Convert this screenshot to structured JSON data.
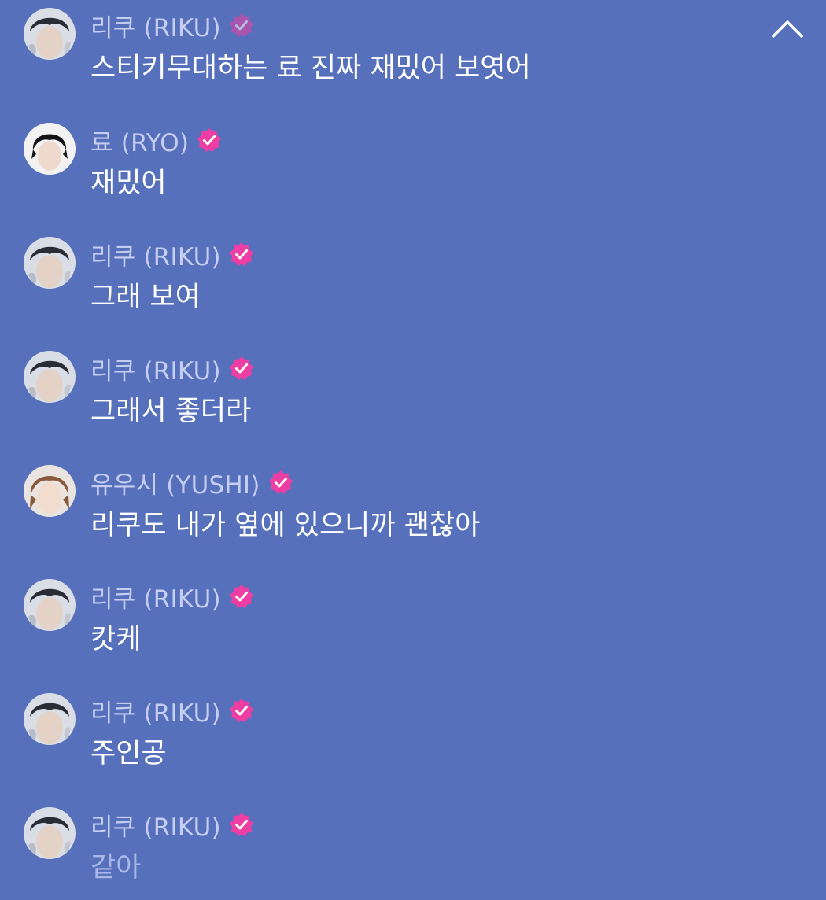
{
  "chat": {
    "collapse_icon": "chevron-up-icon",
    "verified_icon": "verified-badge-icon",
    "colors": {
      "background": "#5670bb",
      "name": "#c5cdf0",
      "message": "#ffffff",
      "badge": "#ee3ea3"
    },
    "messages": [
      {
        "author": "리쿠 (RIKU)",
        "avatar": "riku-avatar",
        "text": "스티키무대하는 료 진짜 재밌어 보엿어"
      },
      {
        "author": "료 (RYO)",
        "avatar": "ryo-avatar",
        "text": "재밌어"
      },
      {
        "author": "리쿠 (RIKU)",
        "avatar": "riku-avatar",
        "text": "그래 보여"
      },
      {
        "author": "리쿠 (RIKU)",
        "avatar": "riku-avatar",
        "text": "그래서 좋더라"
      },
      {
        "author": "유우시 (YUSHI)",
        "avatar": "yushi-avatar",
        "text": "리쿠도 내가 옆에 있으니까 괜찮아"
      },
      {
        "author": "리쿠 (RIKU)",
        "avatar": "riku-avatar",
        "text": "캇케"
      },
      {
        "author": "리쿠 (RIKU)",
        "avatar": "riku-avatar",
        "text": "주인공"
      },
      {
        "author": "리쿠 (RIKU)",
        "avatar": "riku-avatar",
        "text": "같아"
      }
    ]
  }
}
